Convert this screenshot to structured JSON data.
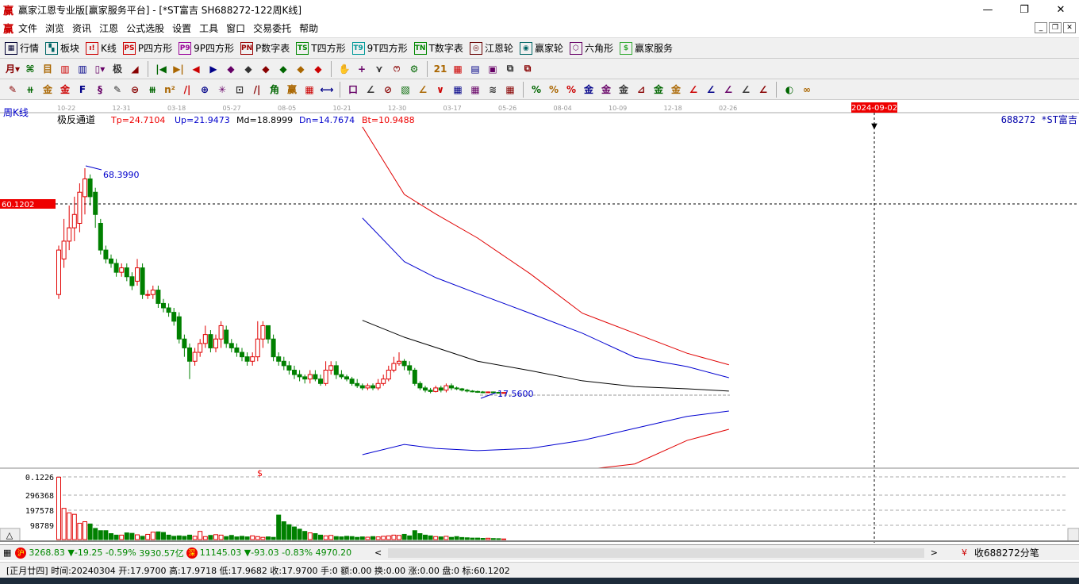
{
  "window": {
    "logo": "赢",
    "title": "赢家江恩专业版[赢家服务平台] - [*ST富吉  SH688272-122周K线]",
    "minimize": "—",
    "restore": "❐",
    "close": "✕"
  },
  "menu": [
    "文件",
    "浏览",
    "资讯",
    "江恩",
    "公式选股",
    "设置",
    "工具",
    "窗口",
    "交易委托",
    "帮助"
  ],
  "toolbar1": [
    {
      "icon": "▦",
      "label": "行情",
      "color": "#003"
    },
    {
      "icon": "▚",
      "label": "板块",
      "color": "#066"
    },
    {
      "icon": "ı!",
      "label": "K线",
      "color": "#c00"
    },
    {
      "icon": "PS",
      "label": "P四方形",
      "color": "#c00"
    },
    {
      "icon": "P9",
      "label": "9P四方形",
      "color": "#909"
    },
    {
      "icon": "PN",
      "label": "P数字表",
      "color": "#900"
    },
    {
      "icon": "TS",
      "label": "T四方形",
      "color": "#080"
    },
    {
      "icon": "T9",
      "label": "9T四方形",
      "color": "#099"
    },
    {
      "icon": "TN",
      "label": "T数字表",
      "color": "#080"
    },
    {
      "icon": "◎",
      "label": "江恩轮",
      "color": "#600"
    },
    {
      "icon": "◉",
      "label": "赢家轮",
      "color": "#066"
    },
    {
      "icon": "⬡",
      "label": "六角形",
      "color": "#606"
    },
    {
      "icon": "$",
      "label": "赢家服务",
      "color": "#3a3"
    }
  ],
  "toolbar2": [
    "月▾",
    "⌘",
    "目",
    "▥",
    "▥",
    "▯▾",
    "极",
    "◢",
    "|◀",
    "▶|",
    "◀",
    "▶",
    "◆",
    "◆",
    "◆",
    "◆",
    "◆",
    "◆",
    "✋",
    "+",
    "⋎",
    "ෆ",
    "⚙",
    "21",
    "▦",
    "▤",
    "▣",
    "⧉",
    "⧉"
  ],
  "toolbar3": [
    "✎",
    "⧺",
    "金",
    "金",
    "F",
    "§",
    "✎",
    "⊜",
    "⧻",
    "n²",
    "/|",
    "⊕",
    "✳",
    "⊡",
    "/|",
    "角",
    "赢",
    "▦",
    "⟷",
    "口",
    "∠",
    "⊘",
    "▧",
    "∠",
    "∨",
    "▦",
    "▦",
    "≋",
    "▦",
    "%",
    "%",
    "%",
    "金",
    "金",
    "金",
    "⊿",
    "金",
    "金",
    "∠",
    "∠",
    "∠",
    "∠",
    "∠",
    "◐",
    "∞"
  ],
  "chart": {
    "period_label": "周K线",
    "time_ticks": [
      "10-22",
      "12-31",
      "03-18",
      "05-27",
      "08-05",
      "10-21",
      "12-30",
      "03-17",
      "05-26",
      "08-04",
      "10-09",
      "12-18",
      "02-26"
    ],
    "cursor_date": "2024-09-02",
    "stock": "688272 *ST富吉",
    "indicator": {
      "name": "极反通道",
      "tp": "Tp=24.7104",
      "up": "Up=21.9473",
      "md": "Md=18.8999",
      "dn": "Dn=14.7674",
      "bt": "Bt=10.9488"
    },
    "high_label": "68.3990",
    "low_label": "17.5600",
    "cursor_price": "60.1202",
    "vol_labels": [
      "0.1226",
      "296368",
      "197578",
      "98789"
    ],
    "vol_marker": "$",
    "collapse_button": "△"
  },
  "chart_data": {
    "type": "candlestick",
    "price_range": [
      -2,
      80
    ],
    "candles": [
      [
        40,
        50,
        51,
        39
      ],
      [
        48,
        52,
        57,
        46
      ],
      [
        52,
        55,
        60,
        50
      ],
      [
        55,
        58,
        62,
        52
      ],
      [
        56,
        63,
        65,
        54
      ],
      [
        62,
        66,
        68.4,
        58
      ],
      [
        66,
        62,
        67,
        60
      ],
      [
        63,
        58,
        64,
        55
      ],
      [
        56,
        50,
        57,
        49
      ],
      [
        50,
        48,
        51,
        47
      ],
      [
        48,
        47,
        49,
        46
      ],
      [
        47,
        45,
        48,
        44
      ],
      [
        45,
        46,
        47,
        44
      ],
      [
        46,
        44,
        47,
        43
      ],
      [
        44,
        42,
        45,
        41
      ],
      [
        43,
        46,
        48,
        42
      ],
      [
        46,
        40,
        47,
        39
      ],
      [
        40,
        40,
        41,
        39
      ],
      [
        40,
        41,
        42,
        39
      ],
      [
        41,
        38,
        42,
        37
      ],
      [
        38,
        37,
        39,
        36
      ],
      [
        37,
        36,
        38,
        35
      ],
      [
        36,
        34,
        37,
        33
      ],
      [
        35,
        30,
        36,
        29
      ],
      [
        30,
        28,
        31,
        26
      ],
      [
        28,
        25,
        29,
        21
      ],
      [
        25,
        27,
        28,
        24
      ],
      [
        27,
        29,
        30,
        26
      ],
      [
        29,
        31,
        33,
        28
      ],
      [
        31,
        28,
        32,
        27
      ],
      [
        28,
        30,
        31,
        27
      ],
      [
        30,
        33,
        34,
        28
      ],
      [
        32,
        29,
        33,
        28
      ],
      [
        29,
        28,
        30,
        27
      ],
      [
        28,
        27,
        29,
        26
      ],
      [
        27,
        26,
        28,
        25
      ],
      [
        26,
        25,
        27,
        24
      ],
      [
        25,
        26,
        27,
        24
      ],
      [
        26,
        30,
        34,
        25
      ],
      [
        30,
        33,
        34,
        28
      ],
      [
        33,
        30,
        33,
        29
      ],
      [
        30,
        26,
        31,
        25
      ],
      [
        26,
        25,
        27,
        24
      ],
      [
        25,
        24,
        26,
        23
      ],
      [
        24,
        23,
        25,
        22
      ],
      [
        23,
        22,
        24,
        21
      ],
      [
        22,
        21.5,
        23,
        20.5
      ],
      [
        21.5,
        21,
        22,
        20
      ],
      [
        21,
        22,
        23,
        20
      ],
      [
        22,
        21,
        23,
        20.5
      ],
      [
        21,
        20,
        22,
        19.5
      ],
      [
        20,
        23,
        25,
        19.5
      ],
      [
        23,
        24,
        25,
        22
      ],
      [
        24,
        22,
        25,
        21
      ],
      [
        22,
        21.5,
        23,
        21
      ],
      [
        21.5,
        21,
        22,
        20.5
      ],
      [
        21,
        20,
        21.5,
        19.5
      ],
      [
        20,
        19.5,
        21,
        19
      ],
      [
        19.5,
        19,
        20,
        18.5
      ],
      [
        19,
        19.5,
        20,
        18.5
      ],
      [
        19.5,
        19,
        20,
        18.5
      ],
      [
        19,
        20,
        21,
        18.5
      ],
      [
        20,
        21,
        22,
        19.5
      ],
      [
        21,
        23,
        24,
        20.5
      ],
      [
        23,
        24.5,
        26,
        22.5
      ],
      [
        24.5,
        25,
        27,
        24
      ],
      [
        25,
        24,
        25.5,
        23
      ],
      [
        24,
        23,
        25,
        22
      ],
      [
        23,
        20,
        23.5,
        19.5
      ],
      [
        20,
        19,
        20.5,
        18.5
      ],
      [
        19,
        18.5,
        19.5,
        18
      ],
      [
        18.5,
        18.2,
        19,
        17.8
      ],
      [
        18.2,
        19,
        19.5,
        18
      ],
      [
        19,
        18.5,
        19.5,
        18
      ],
      [
        18.5,
        19.5,
        20,
        18
      ],
      [
        19.5,
        19,
        20,
        18.5
      ],
      [
        19,
        18.8,
        19.3,
        18.5
      ],
      [
        18.8,
        18.5,
        19,
        18.2
      ],
      [
        18.5,
        18.3,
        18.8,
        18
      ],
      [
        18.3,
        18.2,
        18.5,
        18
      ],
      [
        18.2,
        18.1,
        18.4,
        17.9
      ],
      [
        18.1,
        18.0,
        18.3,
        17.8
      ],
      [
        18.0,
        18.1,
        18.2,
        17.9
      ],
      [
        18.1,
        18.0,
        18.2,
        17.9
      ],
      [
        18.0,
        17.97,
        18.1,
        17.9
      ],
      [
        17.97,
        17.97,
        17.97,
        17.96
      ]
    ],
    "volumes": [
      420000,
      210000,
      180000,
      170000,
      110000,
      120000,
      105000,
      75000,
      60000,
      60000,
      40000,
      30000,
      30000,
      45000,
      42000,
      32000,
      22000,
      35000,
      50000,
      52000,
      48000,
      30000,
      22000,
      25000,
      22000,
      30000,
      22000,
      55000,
      20000,
      28000,
      33000,
      30000,
      20000,
      28000,
      18000,
      22000,
      18000,
      25000,
      20000,
      15000,
      18000,
      15000,
      165000,
      120000,
      100000,
      85000,
      70000,
      55000,
      45000,
      40000,
      30000,
      25000,
      28000,
      20000,
      18000,
      22000,
      20000,
      15000,
      18000,
      16000,
      20000,
      18000,
      22000,
      25000,
      30000,
      28000,
      35000,
      25000,
      60000,
      40000,
      30000,
      25000,
      20000,
      18000,
      22000,
      15000,
      20000,
      14000,
      12000,
      10000,
      10000,
      8000,
      9000,
      7000,
      6000,
      4000
    ],
    "channels": {
      "x_index": [
        58,
        66,
        72,
        80,
        90,
        100,
        110,
        120,
        128
      ],
      "tp": [
        77.7,
        62.5,
        58.1,
        52.7,
        44.7,
        35.8,
        31.3,
        26.8,
        24.2
      ],
      "up": [
        57.2,
        47.4,
        43.8,
        40.2,
        35.8,
        31.3,
        25.9,
        23.8,
        21.3
      ],
      "md": [
        34.2,
        30.4,
        28.1,
        25.0,
        22.9,
        20.6,
        19.3,
        18.8,
        18.3
      ],
      "dn": [
        4.0,
        6.3,
        5.4,
        4.9,
        5.4,
        7.2,
        9.9,
        12.6,
        13.8
      ],
      "bt_x_index": [
        103,
        110,
        120,
        128
      ],
      "bt": [
        -1.0,
        1.9,
        7.2,
        9.7
      ]
    },
    "colors": {
      "up": "#e00000",
      "down": "#008000",
      "tp": "#e00000",
      "upline": "#0000d0",
      "md": "#000000",
      "dn": "#0000d0",
      "bt": "#e00000"
    }
  },
  "status": {
    "sh_badge": "沪",
    "sh": "3268.83",
    "sh_chg": "▼-19.25",
    "sh_pct": "-0.59%",
    "sh_amt": "3930.57亿",
    "sz_badge": "深",
    "sz": "11145.03",
    "sz_chg": "▼-93.03",
    "sz_pct": "-0.83%",
    "sz_amt": "4970.20",
    "scroll_left": "<",
    "scroll_right": ">",
    "receive": "收688272分笔",
    "detail": "[正月廿四] 时间:20240304 开:17.9700 高:17.9718 低:17.9682 收:17.9700 手:0 额:0.00 换:0.00 涨:0.00 盘:0 标:60.1202"
  }
}
